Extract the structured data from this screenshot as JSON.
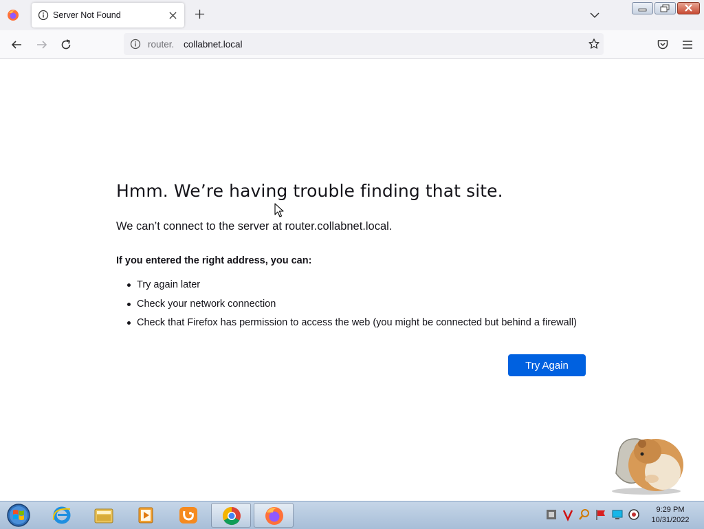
{
  "browser": {
    "tab": {
      "title": "Server Not Found"
    },
    "url": {
      "host_prefix": "router.",
      "host_main": "collabnet.local"
    }
  },
  "error_page": {
    "title": "Hmm. We’re having trouble finding that site.",
    "description": "We can’t connect to the server at router.collabnet.local.",
    "suggestions_heading": "If you entered the right address, you can:",
    "suggestions": [
      "Try again later",
      "Check your network connection",
      "Check that Firefox has permission to access the web (you might be connected but behind a firewall)"
    ],
    "try_again_label": "Try Again"
  },
  "taskbar": {
    "pinned": [
      "internet-explorer-icon",
      "file-explorer-icon",
      "media-player-icon",
      "uc-browser-icon",
      "chrome-icon",
      "firefox-icon"
    ],
    "clock": {
      "time": "9:29 PM",
      "date": "10/31/2022"
    }
  },
  "colors": {
    "accent": "#0061e0",
    "taskbar": "#b7cbe1"
  }
}
